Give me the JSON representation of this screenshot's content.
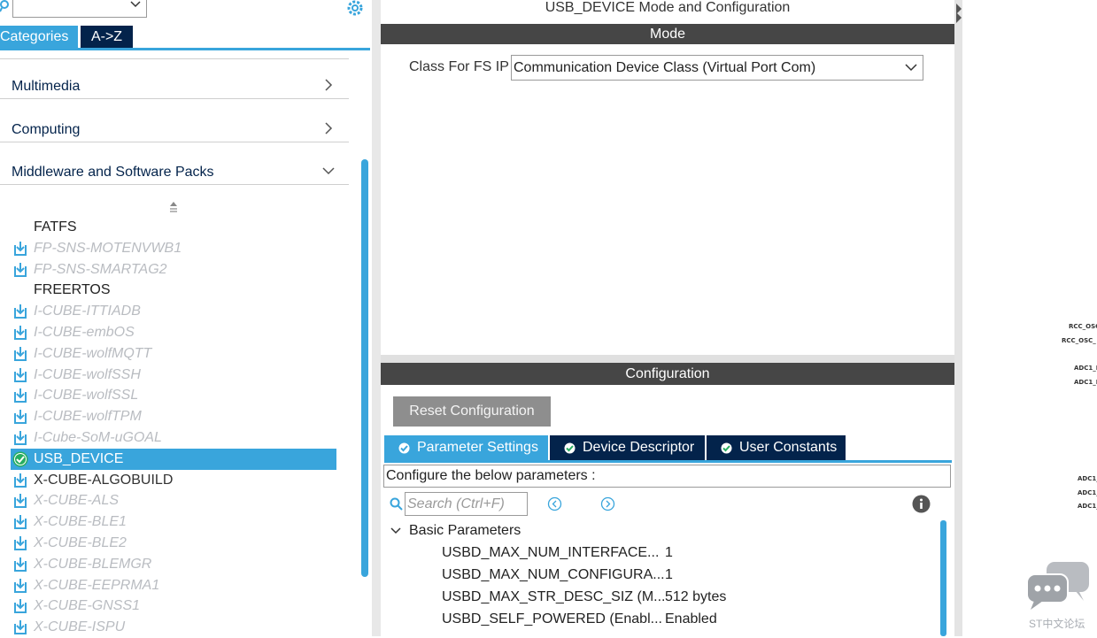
{
  "left_panel": {
    "search_value": "",
    "tabs": {
      "categories": "Categories",
      "az": "A->Z"
    },
    "categories": [
      {
        "label": "Multimedia",
        "state": "collapsed"
      },
      {
        "label": "Computing",
        "state": "collapsed"
      },
      {
        "label": "Middleware and Software Packs",
        "state": "expanded"
      }
    ],
    "items": [
      {
        "label": "FATFS",
        "status": "none"
      },
      {
        "label": "FP-SNS-MOTENVWB1",
        "status": "available"
      },
      {
        "label": "FP-SNS-SMARTAG2",
        "status": "available"
      },
      {
        "label": "FREERTOS",
        "status": "none"
      },
      {
        "label": "I-CUBE-ITTIADB",
        "status": "available"
      },
      {
        "label": "I-CUBE-embOS",
        "status": "available"
      },
      {
        "label": "I-CUBE-wolfMQTT",
        "status": "available"
      },
      {
        "label": "I-CUBE-wolfSSH",
        "status": "available"
      },
      {
        "label": "I-CUBE-wolfSSL",
        "status": "available"
      },
      {
        "label": "I-CUBE-wolfTPM",
        "status": "available"
      },
      {
        "label": "I-Cube-SoM-uGOAL",
        "status": "available"
      },
      {
        "label": "USB_DEVICE",
        "status": "selected"
      },
      {
        "label": "X-CUBE-ALGOBUILD",
        "status": "installed"
      },
      {
        "label": "X-CUBE-ALS",
        "status": "available"
      },
      {
        "label": "X-CUBE-BLE1",
        "status": "available"
      },
      {
        "label": "X-CUBE-BLE2",
        "status": "available"
      },
      {
        "label": "X-CUBE-BLEMGR",
        "status": "available"
      },
      {
        "label": "X-CUBE-EEPRMA1",
        "status": "available"
      },
      {
        "label": "X-CUBE-GNSS1",
        "status": "available"
      },
      {
        "label": "X-CUBE-ISPU",
        "status": "available"
      }
    ],
    "colors": {
      "accent": "#39a5dc",
      "navy": "#03234b",
      "available_text": "#b9bcc1"
    }
  },
  "center_panel": {
    "title": "USB_DEVICE Mode and Configuration",
    "mode_header": "Mode",
    "class_label": "Class For FS IP",
    "class_value": "Communication Device Class (Virtual Port Com)",
    "config_header": "Configuration",
    "reset_button": "Reset Configuration",
    "tabs": {
      "params": "Parameter Settings",
      "device": "Device Descriptor",
      "constants": "User Constants"
    },
    "configure_text": "Configure the below parameters :",
    "search_placeholder": "Search (Ctrl+F)",
    "group_label": "Basic Parameters",
    "params": [
      {
        "name": "USBD_MAX_NUM_INTERFACE...",
        "value": "1"
      },
      {
        "name": "USBD_MAX_NUM_CONFIGURA...",
        "value": "1"
      },
      {
        "name": "USBD_MAX_STR_DESC_SIZ (M...",
        "value": "512 bytes"
      },
      {
        "name": "USBD_SELF_POWERED (Enabl...",
        "value": "Enabled"
      }
    ]
  },
  "pinout": {
    "labels": [
      "RCC_OSC",
      "RCC_OSC_",
      "ADC1_I",
      "ADC1_I",
      "ADC1_",
      "ADC1_",
      "ADC1_"
    ]
  },
  "watermark": {
    "text": "ST中文论坛"
  }
}
